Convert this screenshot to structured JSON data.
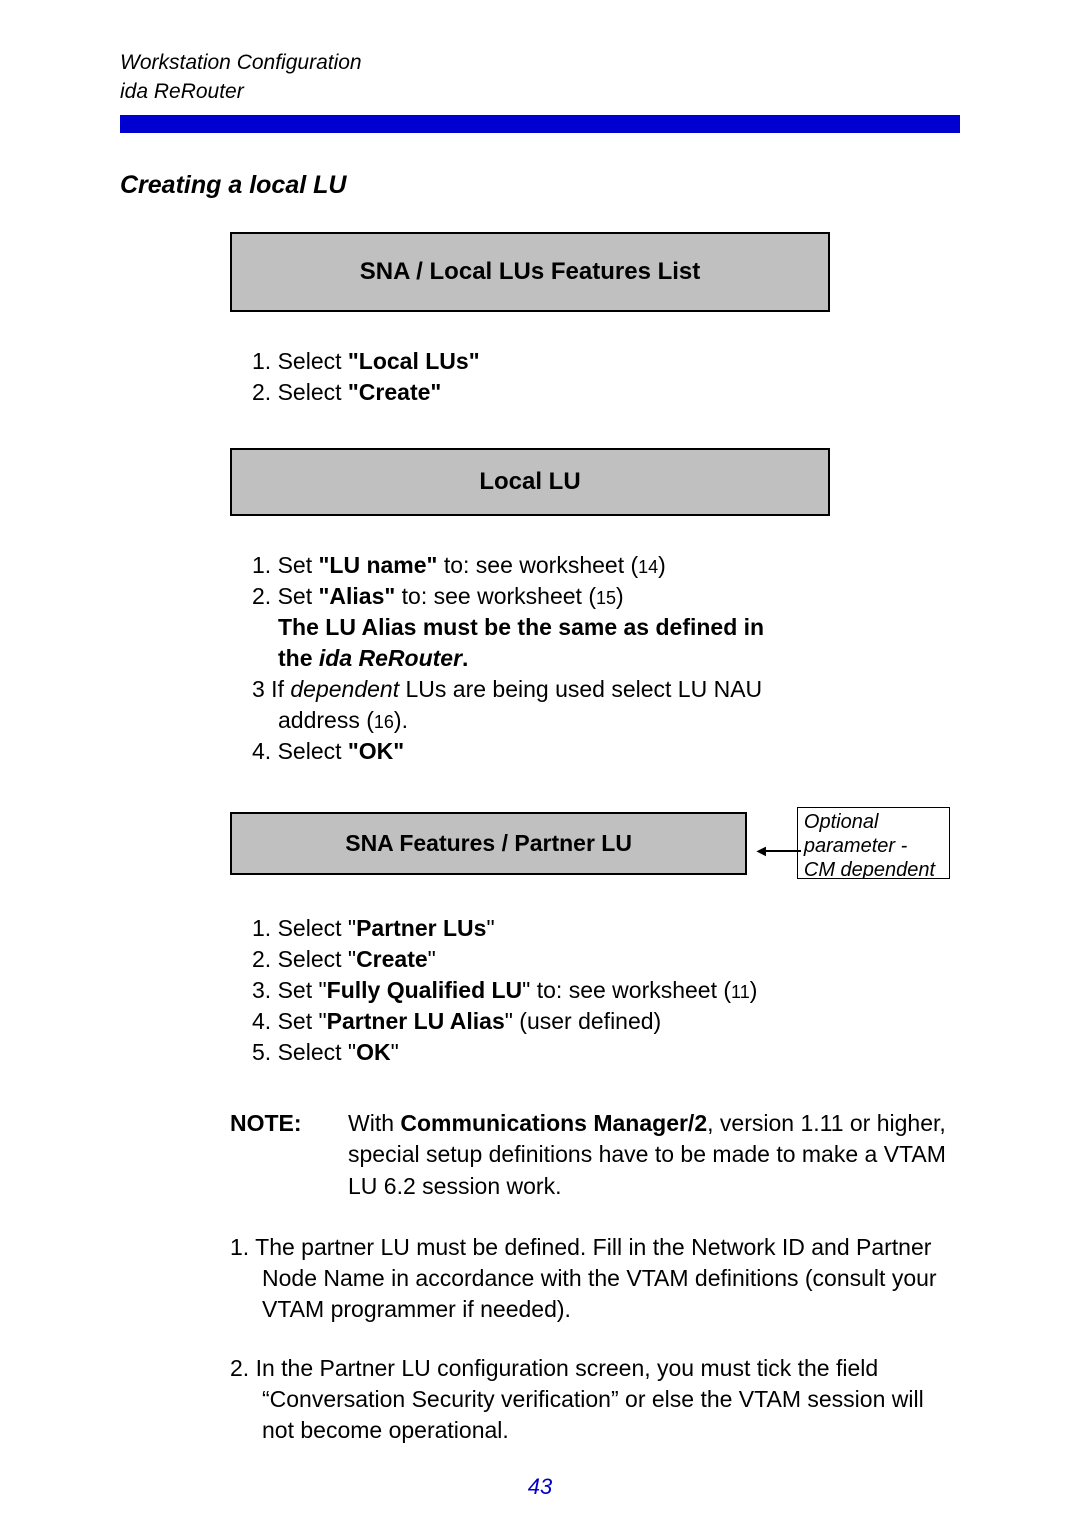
{
  "header": {
    "line1": "Workstation Configuration",
    "line2": "ida ReRouter"
  },
  "section_title": "Creating a local  LU",
  "box1_title": "SNA / Local LUs Features List",
  "steps1": {
    "s1_pre": "1. Select ",
    "s1_bold": "\"Local LUs\"",
    "s2_pre": "2. Select ",
    "s2_bold": "\"Create\""
  },
  "box2_title": "Local LU",
  "steps2": {
    "s1_pre": "1. Set ",
    "s1_bold": "\"LU name\"",
    "s1_post": " to: see worksheet (",
    "s1_ref": "14",
    "s1_close": ")",
    "s2_pre": "2. Set ",
    "s2_bold": "\"Alias\"",
    "s2_post": " to: see worksheet (",
    "s2_ref": "15",
    "s2_close": ")",
    "s2_cont_a": "The LU Alias must be the same as defined in",
    "s2_cont_b_pre": "the ",
    "s2_cont_b_italic": "ida ReRouter",
    "s2_cont_b_post": ".",
    "s3_pre": "3  If ",
    "s3_italic": "dependent",
    "s3_post": " LUs are being used select  LU NAU",
    "s3_cont_pre": "address (",
    "s3_cont_ref": "16",
    "s3_cont_post": ").",
    "s4_pre": "4. Select ",
    "s4_bold": "\"OK\""
  },
  "box3_title": "SNA Features / Partner LU",
  "callout": {
    "l1": "Optional",
    "l2": "parameter -",
    "l3": "CM dependent"
  },
  "steps3": {
    "s1_pre": "1. Select \"",
    "s1_bold": "Partner LUs",
    "s1_post": "\"",
    "s2_pre": "2. Select \"",
    "s2_bold": "Create",
    "s2_post": "\"",
    "s3_pre": "3. Set \"",
    "s3_bold": "Fully Qualified LU",
    "s3_post": "\" to: see worksheet (",
    "s3_ref": "11",
    "s3_close": ")",
    "s4_pre": "4. Set \"",
    "s4_bold": "Partner LU Alias",
    "s4_post": "\" (user defined)",
    "s5_pre": "5. Select \"",
    "s5_bold": "OK",
    "s5_post": "\""
  },
  "note": {
    "label": "NOTE",
    "colon": ":",
    "body_pre": "With ",
    "body_bold": "Communications Manager/2",
    "body_post": ", version 1.11 or higher, special setup definitions have to be made to make a VTAM LU 6.2 session work."
  },
  "paras": {
    "p1": "1. The partner LU must be defined. Fill in the Network ID and Partner Node Name in accordance with the VTAM definitions (consult your VTAM programmer if needed).",
    "p2": "2. In the Partner LU configuration screen, you must tick the field “Conversation Security verification” or else the VTAM session will not become operational."
  },
  "page_number": "43"
}
